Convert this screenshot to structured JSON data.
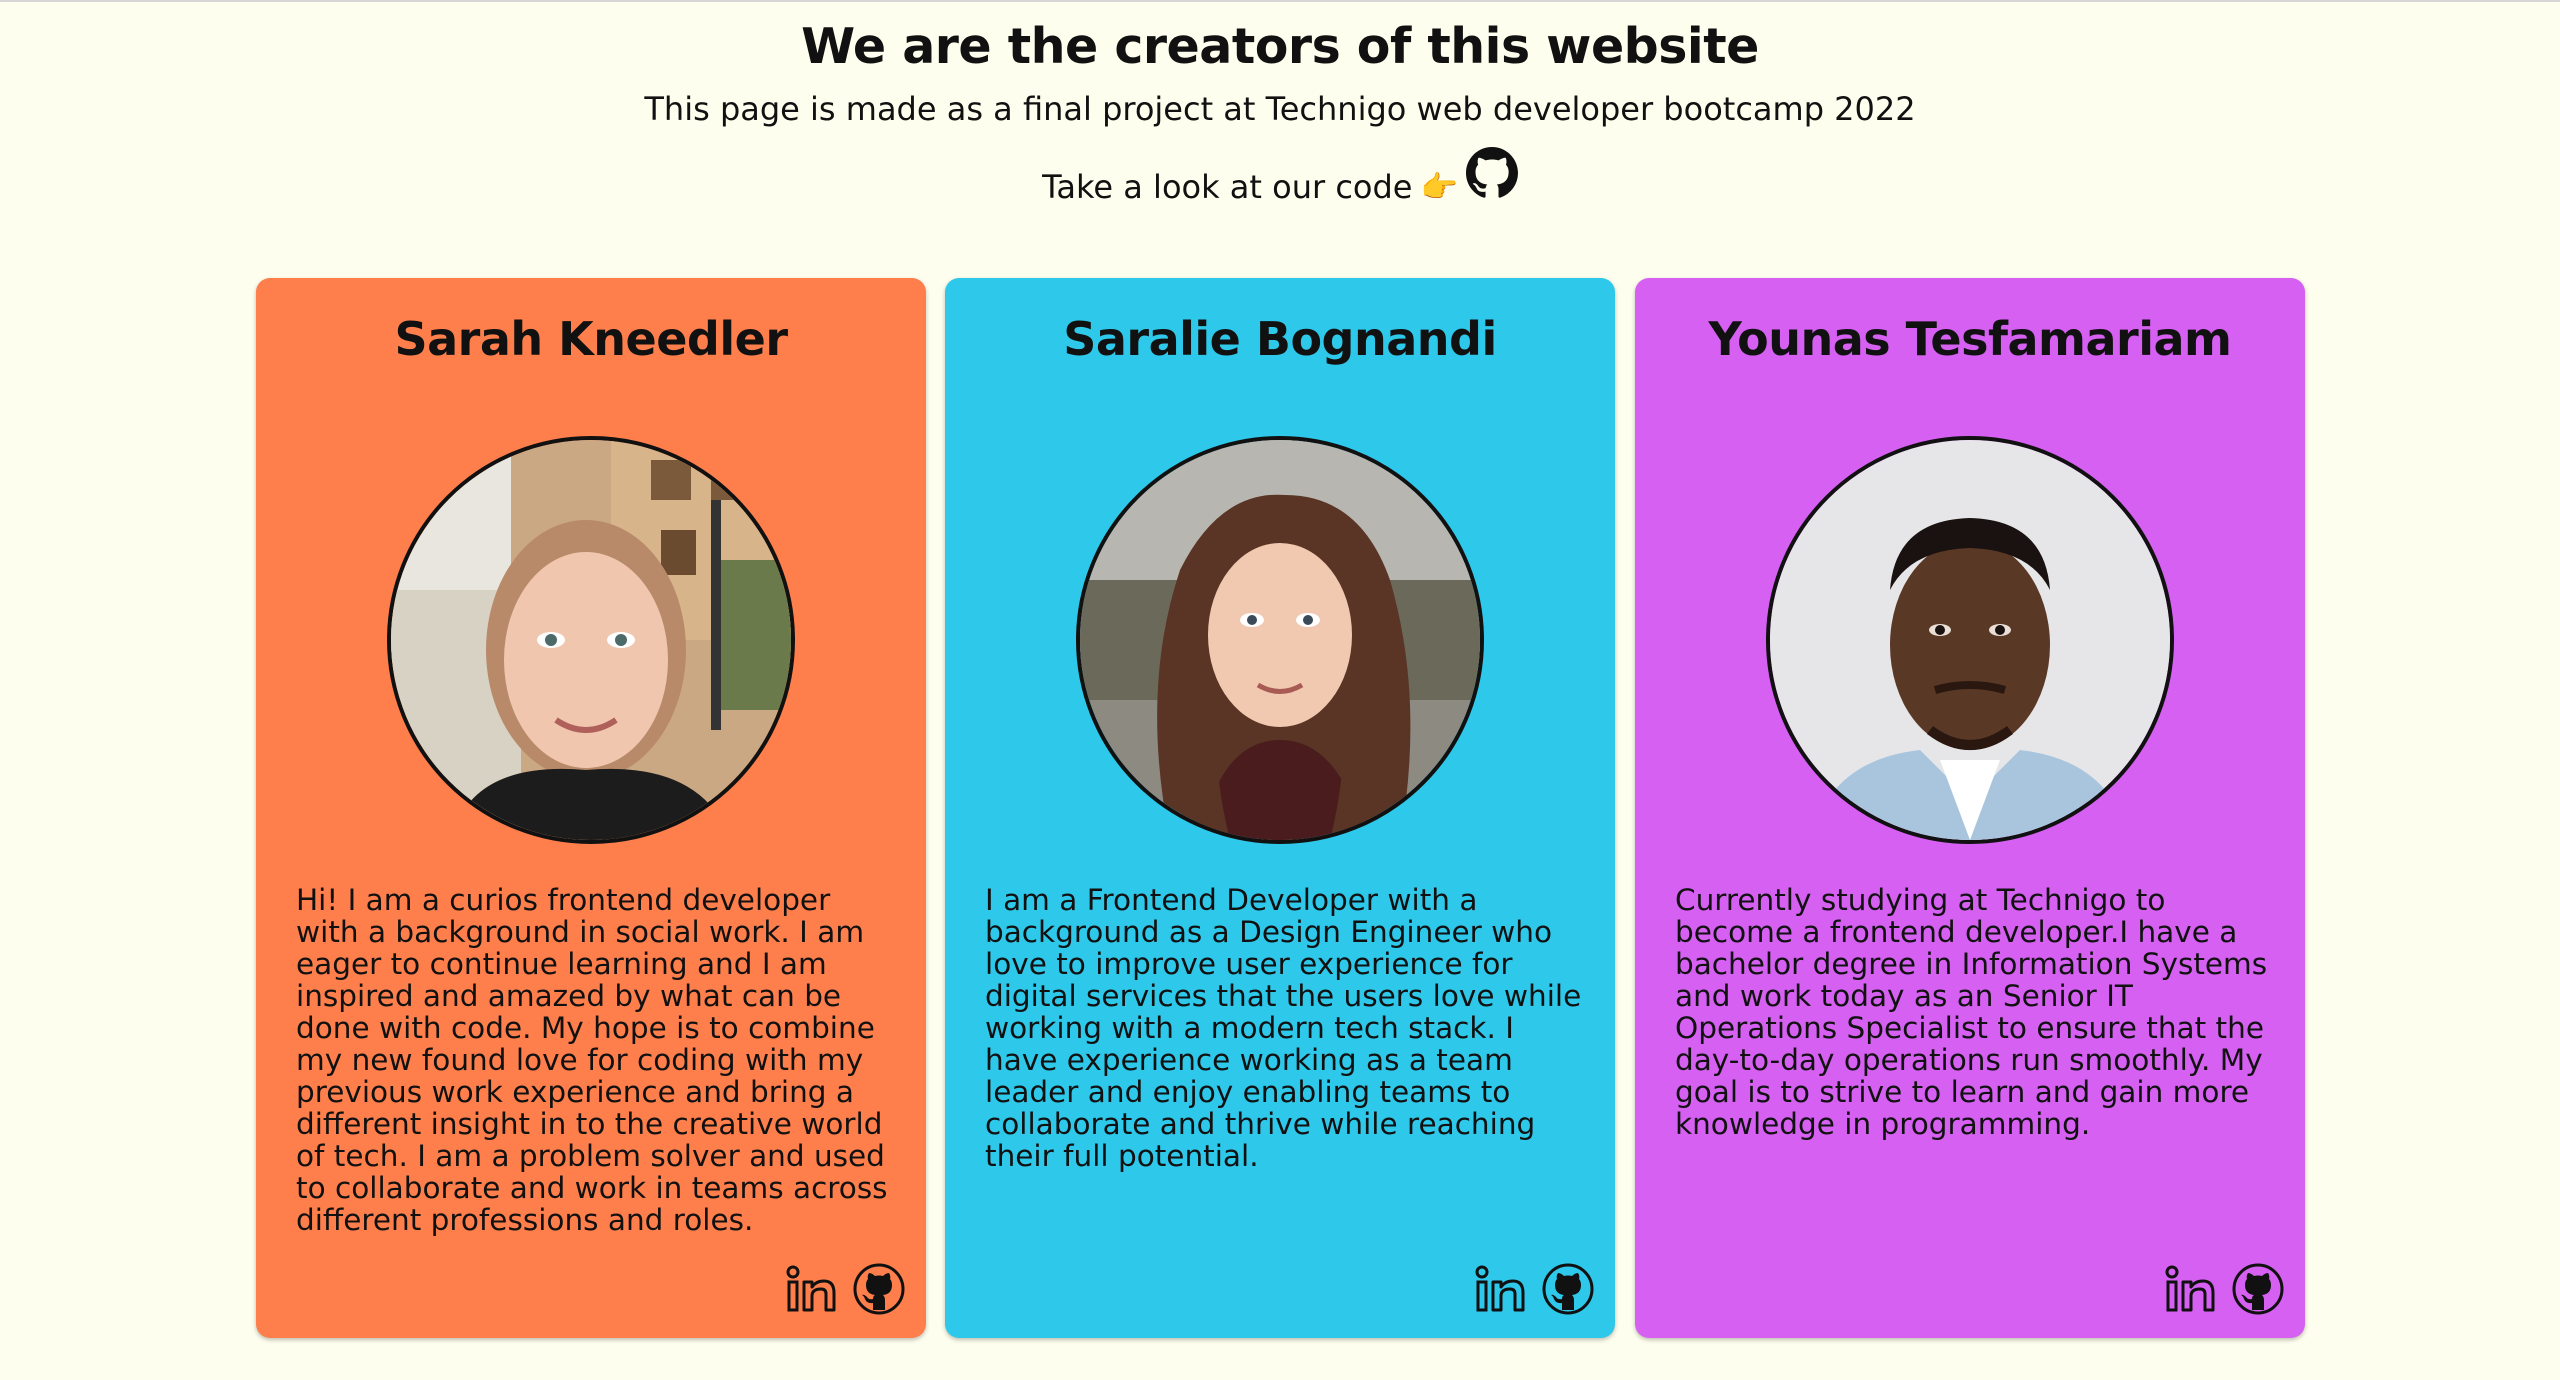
{
  "header": {
    "title": "We are the creators of this website",
    "subtitle": "This page is made as a final project at Technigo web developer bootcamp 2022",
    "code_text": "Take a look at our code",
    "pointer_emoji": "👉"
  },
  "colors": {
    "background": "#fefeee",
    "card_orange": "#fe7f4c",
    "card_blue": "#2ec8ea",
    "card_purple": "#d560f2"
  },
  "cards": [
    {
      "name": "Sarah Kneedler",
      "bio": "Hi! I am a curios frontend developer with a background in social work. I am eager to continue learning and I am inspired and amazed by what can be done with code. My hope is to combine my new found love for coding with my previous work experience and bring a different insight in to the creative world of tech. I am a problem solver and used to collaborate and work in teams across different professions and roles.",
      "icons": [
        "linkedin-icon",
        "github-icon"
      ]
    },
    {
      "name": "Saralie Bognandi",
      "bio": "I am a Frontend Developer with a background as a Design Engineer who love to improve user experience for digital services that the users love while working with a modern tech stack. I have experience working as a team leader and enjoy enabling teams to collaborate and thrive while reaching their full potential.",
      "icons": [
        "linkedin-icon",
        "github-icon"
      ]
    },
    {
      "name": "Younas Tesfamariam",
      "bio": "Currently studying at Technigo to become a frontend developer.I have a bachelor degree in Information Systems and work today as an Senior IT Operations Specialist to ensure that the day-to-day operations run smoothly. My goal is to strive to learn and gain more knowledge in programming.",
      "icons": [
        "linkedin-icon",
        "github-icon"
      ]
    }
  ]
}
